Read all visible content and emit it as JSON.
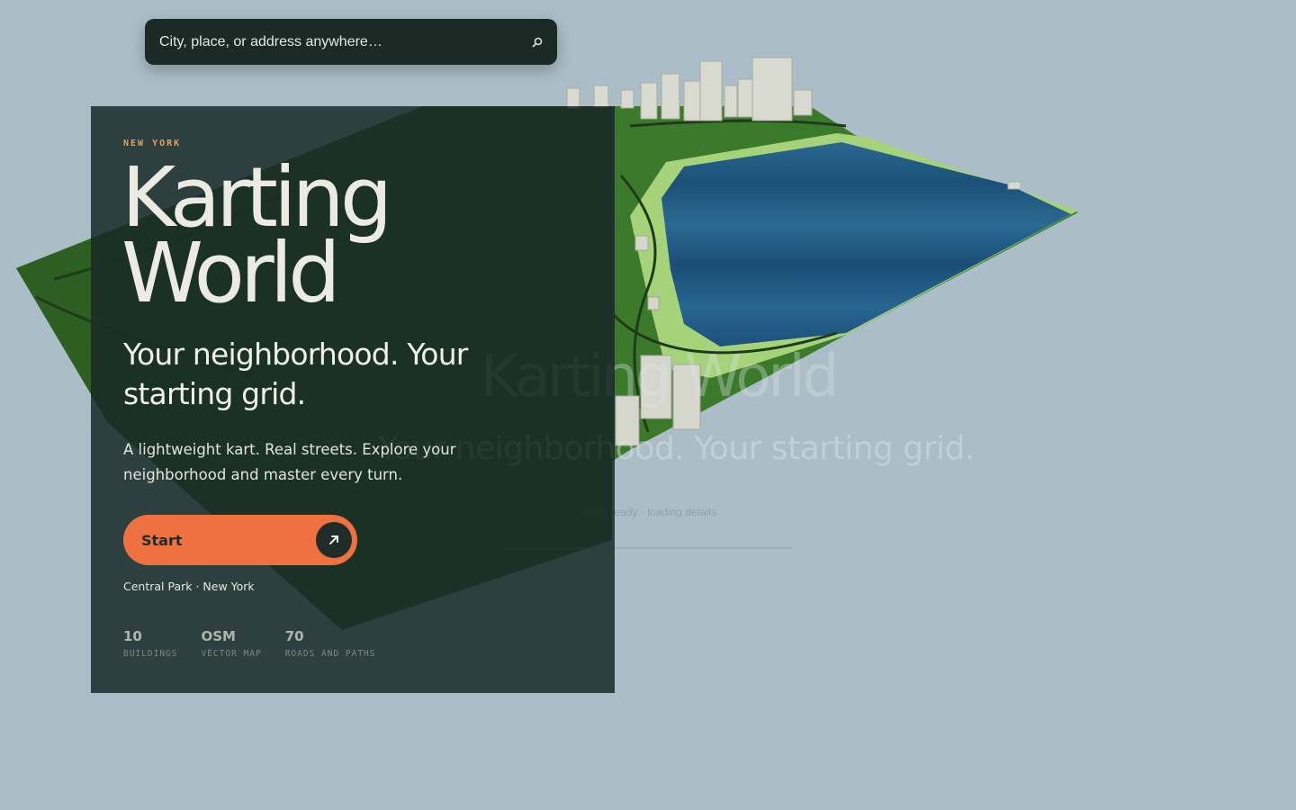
{
  "search": {
    "placeholder": "City, place, or address anywhere…",
    "button_icon": "search-icon"
  },
  "hero": {
    "eyebrow": "NEW YORK",
    "title_line1": "Karting",
    "title_line2": "World",
    "tagline": "Your neighborhood. Your starting grid.",
    "description": "A lightweight kart. Real streets. Explore your neighborhood and master every turn.",
    "start_label": "Start",
    "start_icon": "arrow-up-right-icon",
    "location": "Central Park · New York"
  },
  "stats": [
    {
      "value": "10",
      "label": "BUILDINGS"
    },
    {
      "value": "OSM",
      "label": "VECTOR MAP"
    },
    {
      "value": "70",
      "label": "ROADS AND PATHS"
    }
  ],
  "loader": {
    "title": "Karting World",
    "tagline": "Your neighborhood. Your starting grid.",
    "status": "World ready · loading details",
    "progress": 0.0
  },
  "colors": {
    "background": "#abbdc6",
    "panel": "#1c2b29",
    "accent": "#ee7140",
    "eyebrow": "#e0a066",
    "water": "#24608c",
    "park": "#3d7a2c",
    "path": "#a6d27a"
  }
}
